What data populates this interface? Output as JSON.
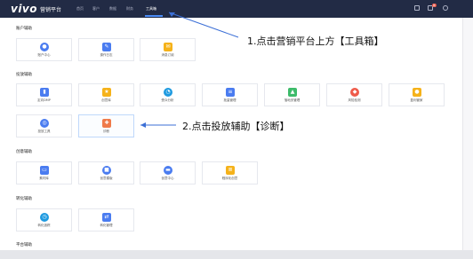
{
  "nav": {
    "brand": "vivo",
    "brand_sub": "营销平台",
    "items": [
      "首页",
      "客户",
      "数据",
      "财务",
      "工具箱"
    ],
    "badge": "新"
  },
  "sections": [
    {
      "title": "账户辅助",
      "cards": [
        {
          "label": "账户中心",
          "icon": "user-icon",
          "color": "#4a7cf0"
        },
        {
          "label": "操作日志",
          "icon": "wrench-icon",
          "color": "#4a7cf0"
        },
        {
          "label": "消息订阅",
          "icon": "mail-icon",
          "color": "#f5b21a"
        }
      ]
    },
    {
      "title": "投放辅助",
      "cards": [
        {
          "label": "定向DMP",
          "icon": "bar-chart-icon",
          "color": "#4a7cf0"
        },
        {
          "label": "创意库",
          "icon": "star-icon",
          "color": "#f5b21a"
        },
        {
          "label": "受众分析",
          "icon": "pie-chart-icon",
          "color": "#1e9ae0"
        },
        {
          "label": "批量管理",
          "icon": "list-icon",
          "color": "#4a7cf0"
        },
        {
          "label": "落地页管理",
          "icon": "image-icon",
          "color": "#3dbb6a"
        },
        {
          "label": "风险检测",
          "icon": "shield-icon",
          "color": "#ef5b4a"
        },
        {
          "label": "盈利管家",
          "icon": "coin-icon",
          "color": "#f5b21a"
        },
        {
          "label": "投放工具",
          "icon": "target-icon",
          "color": "#4a7cf0"
        },
        {
          "label": "诊断",
          "icon": "diagnose-icon",
          "color": "#ef7a4a"
        }
      ]
    },
    {
      "title": "创意辅助",
      "cards": [
        {
          "label": "素材库",
          "icon": "monitor-icon",
          "color": "#4a7cf0"
        },
        {
          "label": "创意模版",
          "icon": "template-icon",
          "color": "#4a7cf0"
        },
        {
          "label": "创意中心",
          "icon": "laptop-icon",
          "color": "#4a7cf0"
        },
        {
          "label": "程序化创意",
          "icon": "doc-icon",
          "color": "#f5b21a"
        }
      ]
    },
    {
      "title": "转化辅助",
      "cards": [
        {
          "label": "转化追踪",
          "icon": "gauge-icon",
          "color": "#1e9ae0"
        },
        {
          "label": "转化管理",
          "icon": "sync-icon",
          "color": "#4a7cf0"
        }
      ]
    },
    {
      "title": "平台辅助",
      "cards": []
    }
  ],
  "annotations": {
    "step1": "1.点击营销平台上方【工具箱】",
    "step2": "2.点击投放辅助【诊断】"
  }
}
